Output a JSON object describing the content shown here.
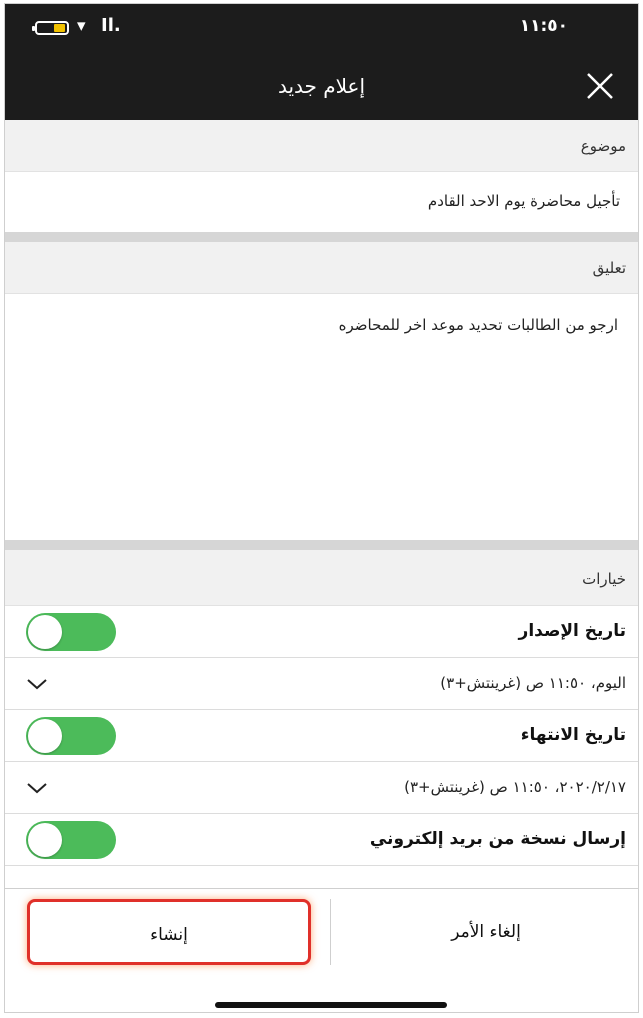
{
  "status_bar": {
    "time": "١١:٥٠"
  },
  "header": {
    "title": "إعلام جديد"
  },
  "subject": {
    "header": "موضوع",
    "value": "تأجيل محاضرة يوم الاحد القادم"
  },
  "comment": {
    "header": "تعليق",
    "value": "ارجو من الطالبات تحديد موعد اخر للمحاضره"
  },
  "options": {
    "header": "خيارات",
    "issue_date_label": "تاريخ الإصدار",
    "issue_date_value": "اليوم، ١١:٥٠ ص (غرينتش+٣)",
    "end_date_label": "تاريخ الانتهاء",
    "end_date_value": "٢٠٢٠/٢/١٧، ١١:٥٠ ص (غرينتش+٣)",
    "email_copy_label": "إرسال نسخة من بريد إلكتروني"
  },
  "footer": {
    "create_label": "إنشاء",
    "cancel_label": "إلغاء الأمر"
  },
  "colors": {
    "accent_green": "#4cbb5a",
    "highlight_red": "#e0302a",
    "nav_bg": "#1c1c1c"
  }
}
